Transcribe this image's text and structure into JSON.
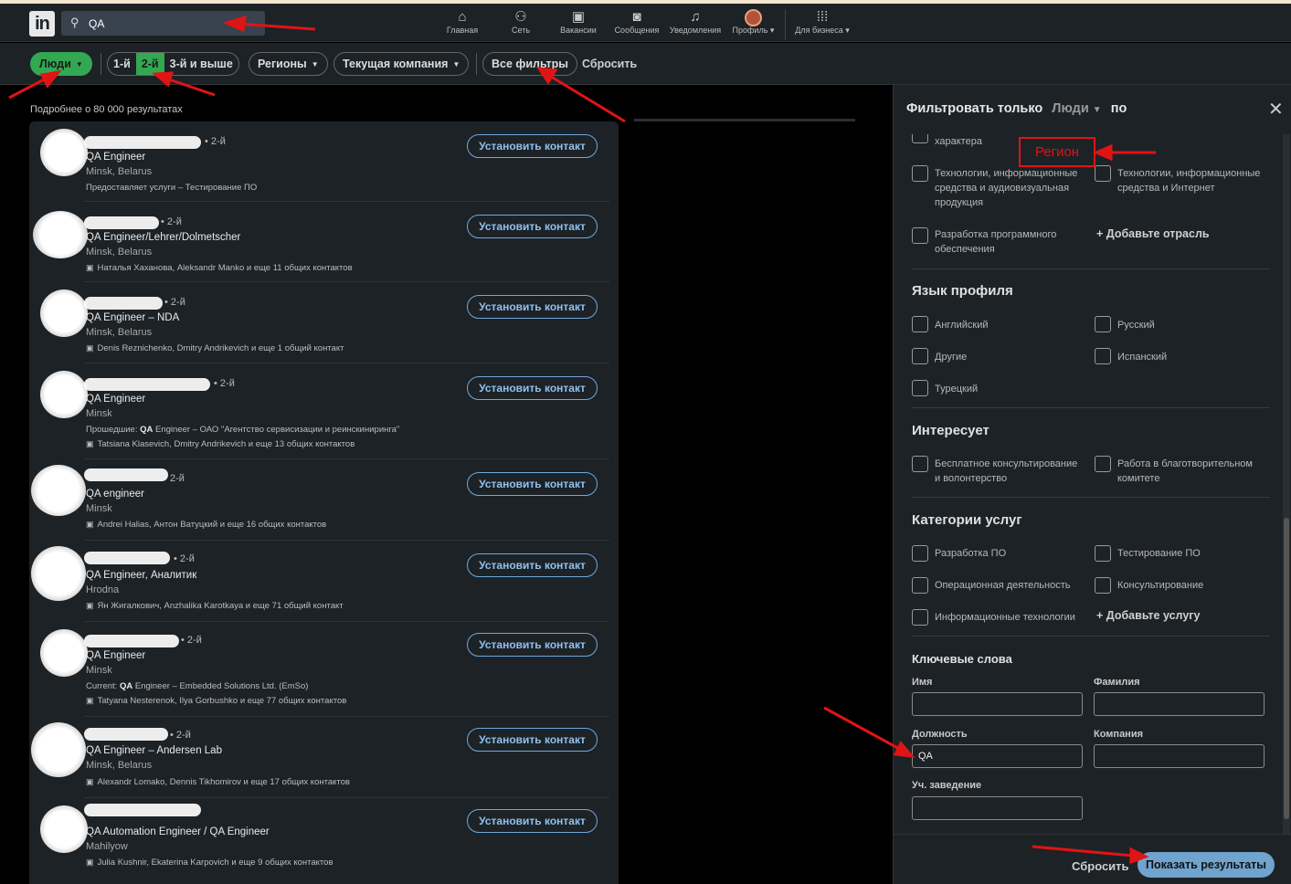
{
  "nav": {
    "logo": "in",
    "search_value": "QA",
    "items": [
      {
        "label": "Главная",
        "icon": "home-icon",
        "glyph": "⌂"
      },
      {
        "label": "Сеть",
        "icon": "network-icon",
        "glyph": "👥"
      },
      {
        "label": "Вакансии",
        "icon": "briefcase-icon",
        "glyph": "💼"
      },
      {
        "label": "Сообщения",
        "icon": "messages-icon",
        "glyph": "💬"
      },
      {
        "label": "Уведомления",
        "icon": "bell-icon",
        "glyph": "🔔"
      },
      {
        "label": "Профиль",
        "icon": "avatar",
        "glyph": ""
      },
      {
        "label": "Для бизнеса",
        "icon": "grid-icon",
        "glyph": "⋮⋮⋮"
      }
    ]
  },
  "filters": {
    "people": "Люди",
    "conn_1": "1-й",
    "conn_2": "2-й",
    "conn_3": "3-й и выше",
    "regions": "Регионы",
    "company": "Текущая компания",
    "all": "Все фильтры",
    "reset": "Сбросить"
  },
  "results": {
    "count": "Подробнее о 80 000 результатах",
    "connect_label": "Установить контакт",
    "items": [
      {
        "degree": "• 2-й",
        "title": "QA Engineer",
        "location": "Minsk, Belarus",
        "meta": "Предоставляет услуги – Тестирование ПО",
        "meta2": ""
      },
      {
        "degree": "• 2-й",
        "title": "QA Engineer/Lehrer/Dolmetscher",
        "location": "Minsk, Belarus",
        "meta": "Наталья Хаханова, Aleksandr Manko и еще 11 общих контактов",
        "meta2": ""
      },
      {
        "degree": "• 2-й",
        "title": "QA Engineer – NDA",
        "location": "Minsk, Belarus",
        "meta": "Denis Reznichenko, Dmitry Andrikevich и еще 1 общий контакт",
        "meta2": ""
      },
      {
        "degree": "• 2-й",
        "title": "QA Engineer",
        "location": "Minsk",
        "meta_prefix": "Прошедшие: ",
        "meta_bold": "QA",
        "meta_rest": " Engineer – ОАО \"Агентство сервисизации и реинскиниринга\"",
        "meta2": "Tatsiana Klasevich, Dmitry Andrikevich и еще 13 общих контактов"
      },
      {
        "degree": "2-й",
        "title": "QA engineer",
        "location": "Minsk",
        "meta": "Andrei Halias, Антон Ватуцкий и еще 16 общих контактов",
        "meta2": ""
      },
      {
        "degree": "• 2-й",
        "title": "QA Engineer, Аналитик",
        "location": "Hrodna",
        "meta": "Ян Жигалкович, Anzhalika Karotkaya и еще 71 общий контакт",
        "meta2": ""
      },
      {
        "degree": "• 2-й",
        "title": "QA Engineer",
        "location": "Minsk",
        "meta_prefix": "Current: ",
        "meta_bold": "QA",
        "meta_rest": " Engineer – Embedded Solutions Ltd. (EmSo)",
        "meta2": "Tatyana Nesterenok, Ilya Gorbushko и еще 77 общих контактов"
      },
      {
        "degree": "• 2-й",
        "title": "QA Engineer – Andersen Lab",
        "location": "Minsk, Belarus",
        "meta": "Alexandr Lomako, Dennis Tikhomirov и еще 17 общих контактов",
        "meta2": ""
      },
      {
        "degree": "",
        "title": "QA Automation Engineer / QA Engineer",
        "location": "Mahilyow",
        "meta": "Julia Kushnir, Ekaterina Karpovich и еще 9 общих контактов",
        "meta2": ""
      }
    ]
  },
  "panel": {
    "title": "Фильтровать только",
    "dropdown": "Люди",
    "suffix": "по",
    "industry_partial": "характера",
    "industry": [
      "Технологии, информационные средства и аудиовизуальная продукция",
      "Технологии, информационные средства и Интернет",
      "Разработка программного обеспечения"
    ],
    "add_industry": "+ Добавьте отрасль",
    "lang_title": "Язык профиля",
    "langs": [
      "Английский",
      "Русский",
      "Другие",
      "Испанский",
      "Турецкий"
    ],
    "interest_title": "Интересует",
    "interests": [
      "Бесплатное консультирование и волонтерство",
      "Работа в благотворительном комитете"
    ],
    "services_title": "Категории услуг",
    "services": [
      "Разработка ПО",
      "Тестирование ПО",
      "Операционная деятельность",
      "Консультирование",
      "Информационные технологии"
    ],
    "add_service": "+ Добавьте услугу",
    "keywords_title": "Ключевые слова",
    "kw_first": "Имя",
    "kw_last": "Фамилия",
    "kw_title": "Должность",
    "kw_title_value": "QA",
    "kw_company": "Компания",
    "kw_school": "Уч. заведение",
    "reset": "Сбросить",
    "show": "Показать результаты"
  },
  "annotation": {
    "region_label": "Регион",
    "color": "#e01414"
  }
}
